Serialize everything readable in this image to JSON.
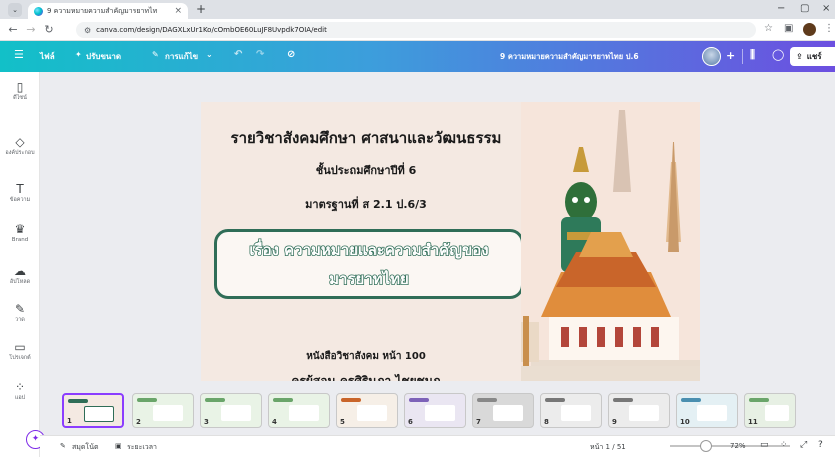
{
  "browser": {
    "tab_title": "9 ความหมายความสำคัญมารยาทไท",
    "tab_close": "×",
    "new_tab": "+",
    "url": "canva.com/design/DAGXLxUr1Ko/cOmbOE60LuJF8Uvpdk7OIA/edit",
    "window_controls": [
      "−",
      "▢",
      "×"
    ]
  },
  "canva_header": {
    "menu_icon": "hamburger-icon",
    "home_label": "ไฟล์",
    "resize_label": "ปรับขนาด",
    "edit_label": "การแก้ไข",
    "doc_title": "9 ความหมายความสำคัญมารยาทไทย ป.6",
    "share_label": "แชร์"
  },
  "sidebar": {
    "items": [
      {
        "label": "ดีไซน์",
        "icon": "layout-icon",
        "glyph": "▯"
      },
      {
        "label": "องค์ประกอบ",
        "icon": "elements-icon",
        "glyph": "◇"
      },
      {
        "label": "ข้อความ",
        "icon": "text-icon",
        "glyph": "T"
      },
      {
        "label": "Brand",
        "icon": "brand-icon",
        "glyph": "♛"
      },
      {
        "label": "อัปโหลด",
        "icon": "upload-icon",
        "glyph": "☁"
      },
      {
        "label": "วาด",
        "icon": "draw-icon",
        "glyph": "✎"
      },
      {
        "label": "โปรเจกต์",
        "icon": "folder-icon",
        "glyph": "▭"
      },
      {
        "label": "แอป",
        "icon": "apps-icon",
        "glyph": "⁘"
      }
    ]
  },
  "slide": {
    "title": "รายวิชาสังคมศึกษา ศาสนาและวัฒนธรรม",
    "grade": "ชั้นประถมศึกษาปีที่ 6",
    "standard": "มาตรฐานที่ ส 2.1 ป.6/3",
    "topic_line1": "เรื่อง ความหมายและความสำคัญของ",
    "topic_line2": "มารยาทไทย",
    "book": "หนังสือวิชาสังคม หน้า 100",
    "teacher": "ครูผู้สอน ครูศิรินภา ไชยชมภู"
  },
  "thumbnails": [
    "1",
    "2",
    "3",
    "4",
    "5",
    "6",
    "7",
    "8",
    "9",
    "10",
    "11"
  ],
  "footer": {
    "notes_label": "สมุดโน้ต",
    "timer_label": "ระยะเวลา",
    "page_label": "หน้า 1 / 51",
    "zoom": "72%",
    "zoom_fraction": 0.3
  }
}
